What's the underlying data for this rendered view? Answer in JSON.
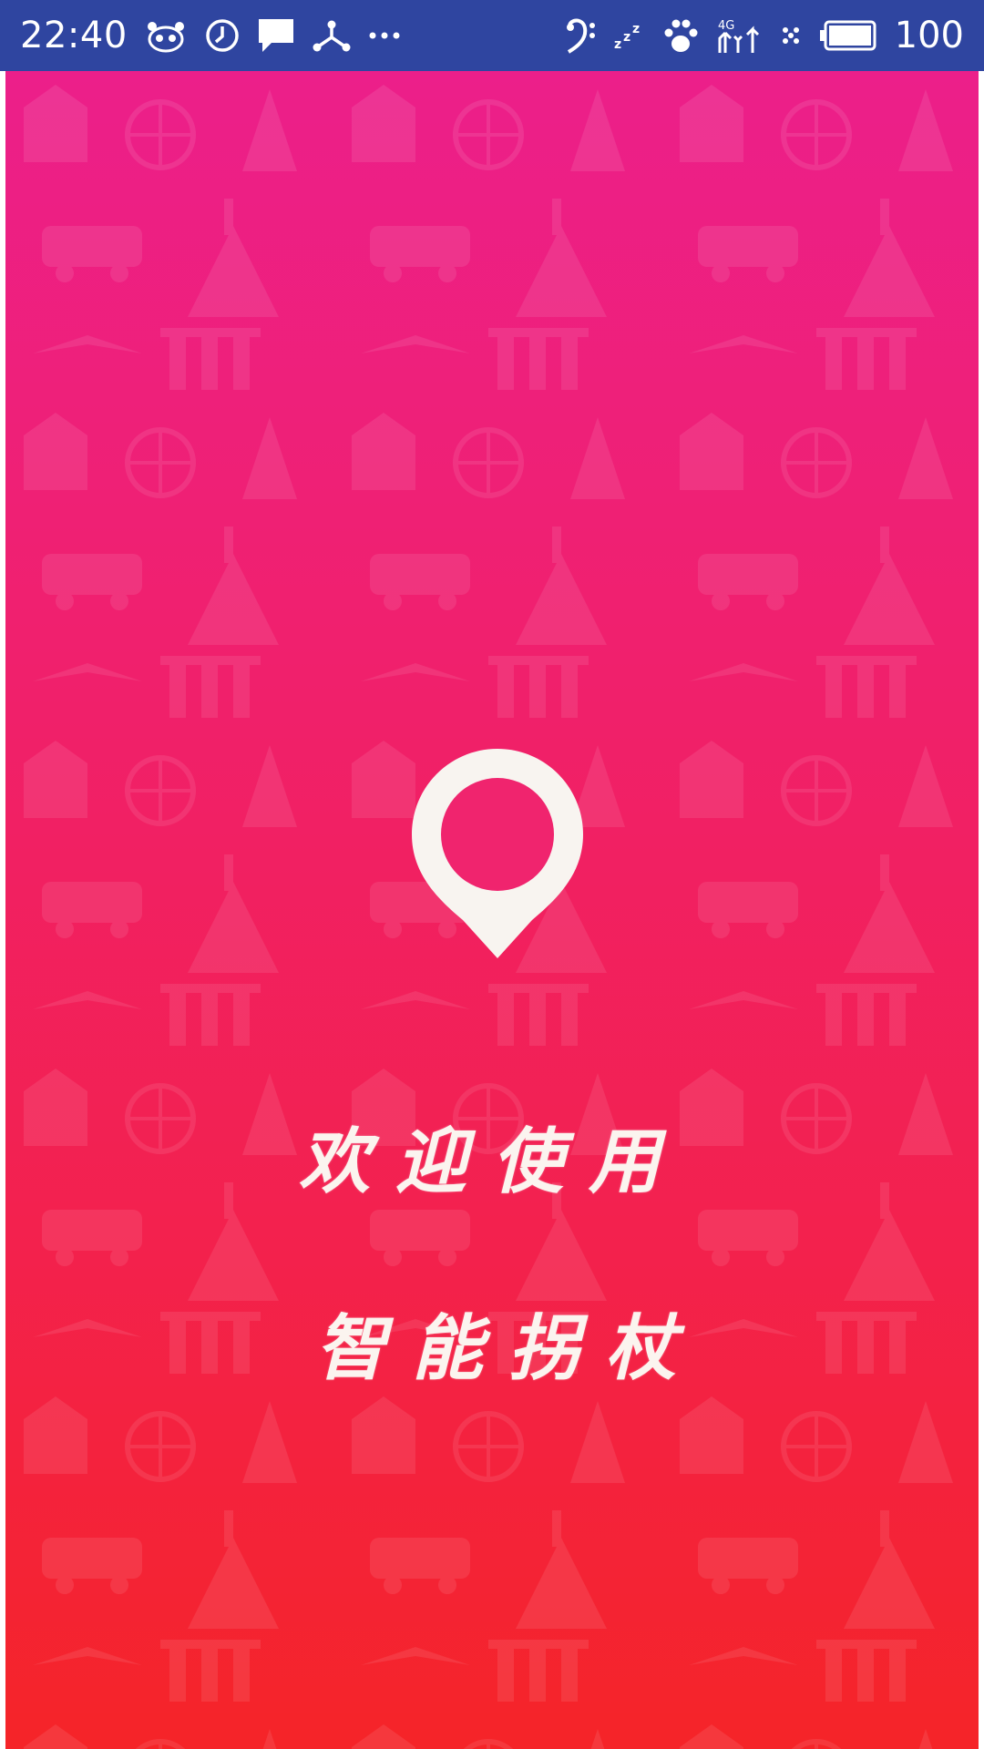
{
  "status_bar": {
    "time": "22:40",
    "battery_level": "100",
    "icons": [
      "panda-icon",
      "clock-icon",
      "message-icon",
      "share-network-icon",
      "more-icon",
      "bass-clef-icon",
      "sleep-icon",
      "paw-icon",
      "signal-4g-icon",
      "bluetooth-dots-icon",
      "battery-icon"
    ],
    "network_label": "4G"
  },
  "splash": {
    "welcome_line": "欢迎使用",
    "app_name": "智能拐杖",
    "pin_icon": "location-pin-icon",
    "colors": {
      "top": "#ec1f8a",
      "bottom": "#f52428",
      "status_bar": "#2f45a0"
    }
  }
}
